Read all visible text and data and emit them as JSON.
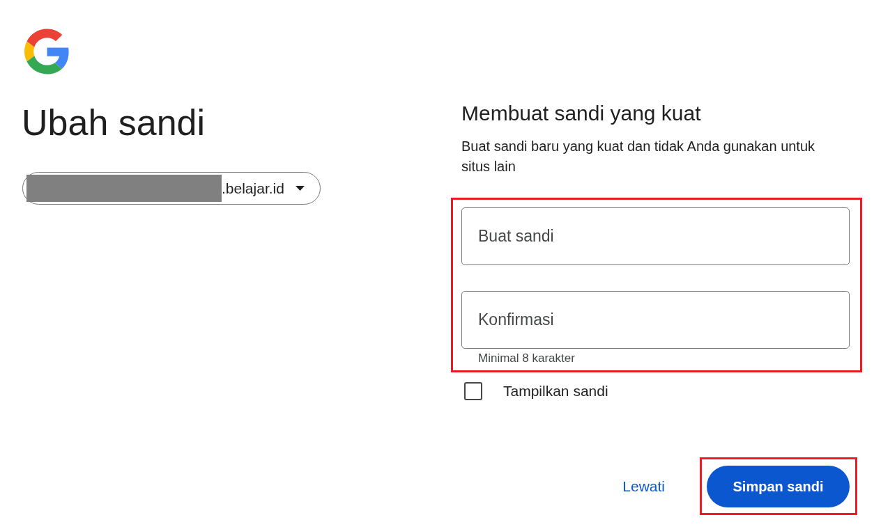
{
  "title": "Ubah sandi",
  "account": {
    "email": ".belajar.id",
    "redacted": true
  },
  "form": {
    "heading": "Membuat sandi yang kuat",
    "description": "Buat sandi baru yang kuat dan tidak Anda gunakan untuk situs lain",
    "highlighted": true,
    "fields": [
      {
        "placeholder": "Buat sandi"
      },
      {
        "placeholder": "Konfirmasi"
      }
    ],
    "hint": "Minimal 8 karakter"
  },
  "show_password": {
    "label": "Tampilkan sandi",
    "checked": false
  },
  "actions": [
    {
      "kind": "link",
      "label": "Lewati",
      "highlighted": false
    },
    {
      "kind": "primary",
      "label": "Simpan sandi",
      "highlighted": true
    }
  ]
}
